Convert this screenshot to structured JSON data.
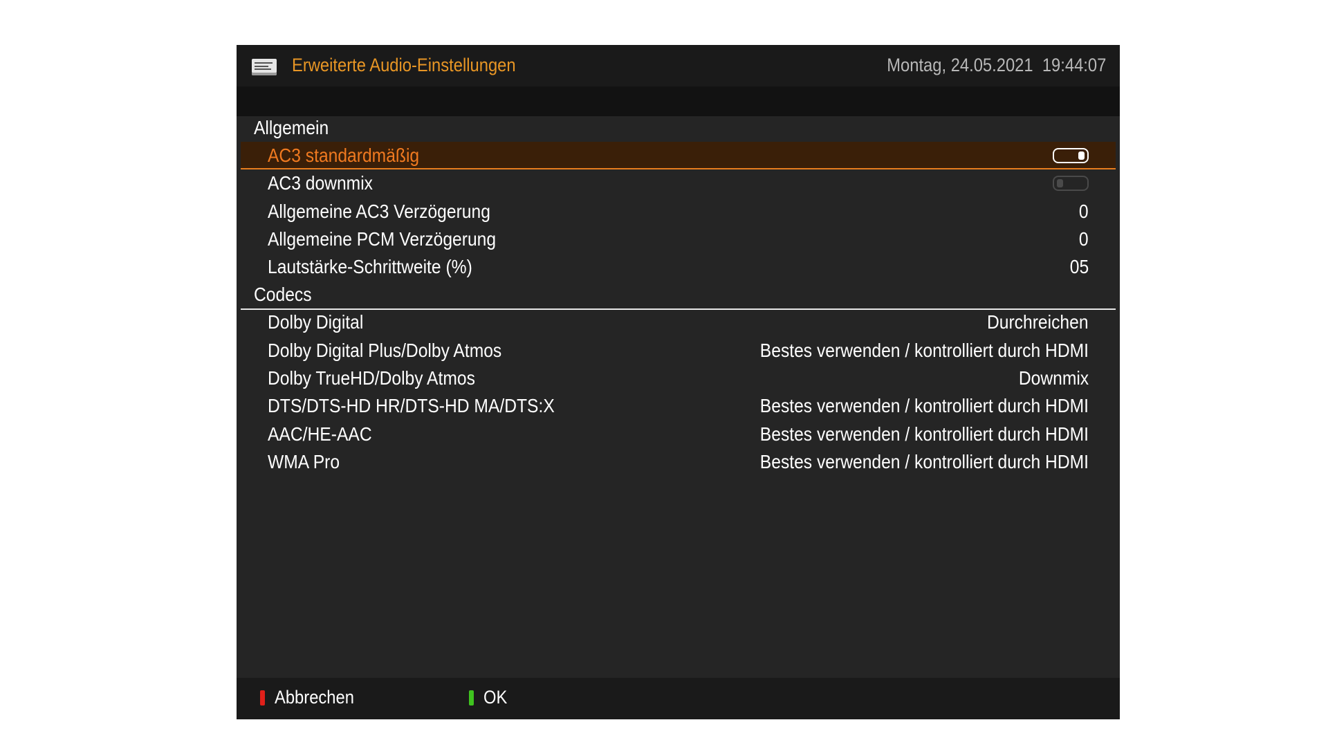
{
  "header": {
    "title": "Erweiterte Audio-Einstellungen",
    "date": "Montag, 24.05.2021",
    "time": "19:44:07",
    "icon": "settings-list-icon"
  },
  "sections": [
    {
      "title": "Allgemein",
      "items": [
        {
          "label": "AC3 standardmäßig",
          "type": "toggle",
          "on": true,
          "selected": true
        },
        {
          "label": "AC3 downmix",
          "type": "toggle",
          "on": false
        },
        {
          "label": "Allgemeine AC3 Verzögerung",
          "type": "value",
          "value": "0"
        },
        {
          "label": "Allgemeine PCM Verzögerung",
          "type": "value",
          "value": "0"
        },
        {
          "label": "Lautstärke-Schrittweite (%)",
          "type": "value",
          "value": "05"
        }
      ]
    },
    {
      "title": "Codecs",
      "items": [
        {
          "label": "Dolby Digital",
          "type": "value",
          "value": "Durchreichen"
        },
        {
          "label": "Dolby Digital Plus/Dolby Atmos",
          "type": "value",
          "value": "Bestes verwenden / kontrolliert durch HDMI"
        },
        {
          "label": "Dolby TrueHD/Dolby Atmos",
          "type": "value",
          "value": "Downmix"
        },
        {
          "label": "DTS/DTS-HD HR/DTS-HD MA/DTS:X",
          "type": "value",
          "value": "Bestes verwenden / kontrolliert durch HDMI"
        },
        {
          "label": "AAC/HE-AAC",
          "type": "value",
          "value": "Bestes verwenden / kontrolliert durch HDMI"
        },
        {
          "label": "WMA Pro",
          "type": "value",
          "value": "Bestes verwenden / kontrolliert durch HDMI"
        }
      ]
    }
  ],
  "footer": {
    "buttons": [
      {
        "label": "Abbrechen",
        "color": "#e0201a",
        "name": "cancel-button"
      },
      {
        "label": "OK",
        "color": "#3fc31f",
        "name": "ok-button"
      }
    ]
  },
  "colors": {
    "accent": "#e87d1e",
    "title": "#e89625",
    "background": "#252525"
  }
}
